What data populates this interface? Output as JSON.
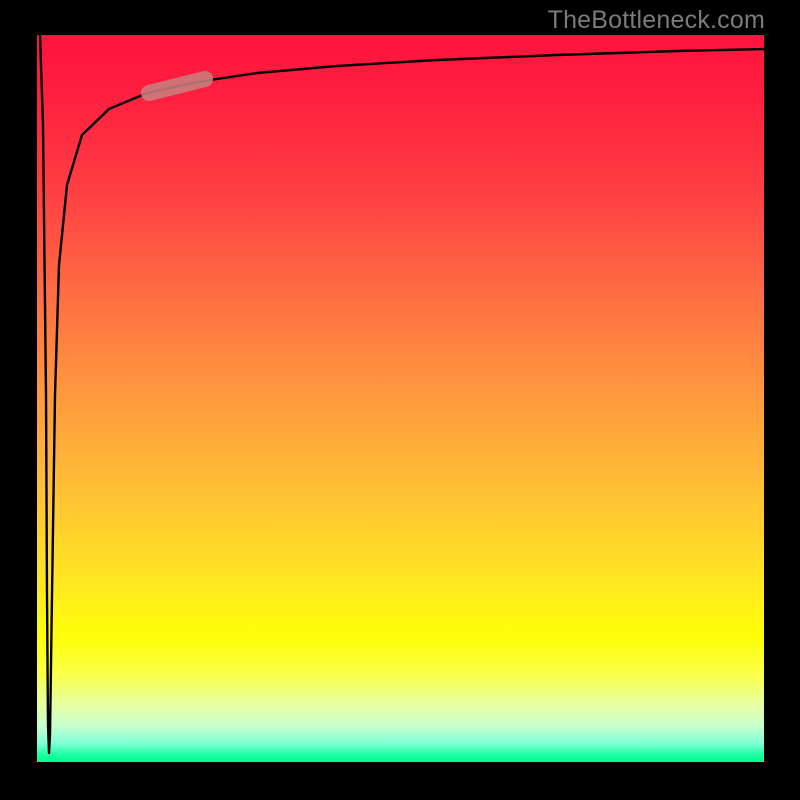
{
  "watermark": "TheBottleneck.com",
  "colors": {
    "frame": "#000000",
    "curve": "#000000",
    "highlight_stroke": "#c77e7e",
    "gradient_stops": [
      "#ff133d",
      "#ff1f3f",
      "#ff4043",
      "#ff6b43",
      "#ff943f",
      "#ffbe36",
      "#ffe622",
      "#ffff08",
      "#faff4b",
      "#e8ffa0",
      "#c8ffce",
      "#7cffd4",
      "#1effa2",
      "#00fe8f"
    ]
  },
  "chart_data": {
    "type": "line",
    "title": "",
    "xlabel": "",
    "ylabel": "",
    "xlim": [
      0,
      100
    ],
    "ylim": [
      0,
      100
    ],
    "legend": false,
    "grid": false,
    "annotations": [],
    "series": [
      {
        "name": "curve",
        "x": [
          0,
          0.5,
          1,
          1.2,
          1.5,
          2,
          3,
          4,
          6,
          10,
          15,
          20,
          30,
          45,
          60,
          80,
          100
        ],
        "y": [
          100,
          40,
          10,
          3,
          30,
          60,
          78,
          84,
          88,
          91,
          92.5,
          93.5,
          94.5,
          95.5,
          96,
          96.5,
          97
        ],
        "note": "Sharp downward spike near x≈1 reaching near y≈3, then steep recovery to a near-horizontal asymptote around y≈96–97. Values are estimates read from the rendered curve against a 0–100 normalized square."
      }
    ],
    "highlight": {
      "description": "Short thick pale-red segment overlaid on the curve near the upper-left bend.",
      "x_range": [
        15,
        22
      ],
      "y_range": [
        92,
        94
      ]
    },
    "background_gradient": {
      "direction": "top-to-bottom",
      "meaning": "red (top) through orange/yellow to green (bottom)",
      "stops_percent": [
        0,
        8,
        22,
        35,
        48,
        62,
        75,
        83,
        88,
        92,
        95,
        97.5,
        99,
        100
      ]
    }
  }
}
